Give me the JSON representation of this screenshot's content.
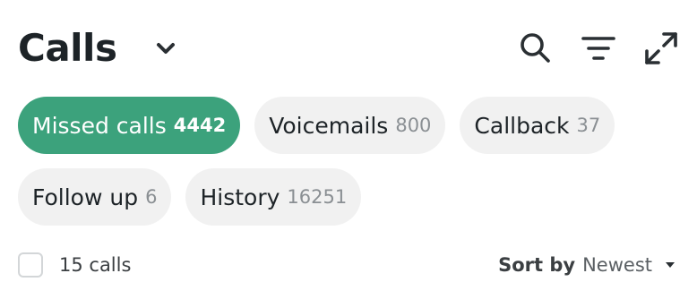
{
  "header": {
    "title": "Calls",
    "icons": {
      "title_dropdown": "chevron-down-icon",
      "search": "search-icon",
      "filter": "filter-icon",
      "expand": "expand-icon"
    }
  },
  "chips": [
    {
      "label": "Missed calls",
      "count": "4442",
      "active": true
    },
    {
      "label": "Voicemails",
      "count": "800",
      "active": false
    },
    {
      "label": "Callback",
      "count": "37",
      "active": false
    },
    {
      "label": "Follow up",
      "count": "6",
      "active": false
    },
    {
      "label": "History",
      "count": "16251",
      "active": false
    }
  ],
  "list": {
    "count_label": "15 calls",
    "sort_label": "Sort by",
    "sort_value": "Newest",
    "select_all_checked": false
  },
  "colors": {
    "accent": "#3ca27c",
    "chip_bg": "#f1f1f1",
    "text": "#1d2327",
    "muted": "#8a8f93"
  }
}
